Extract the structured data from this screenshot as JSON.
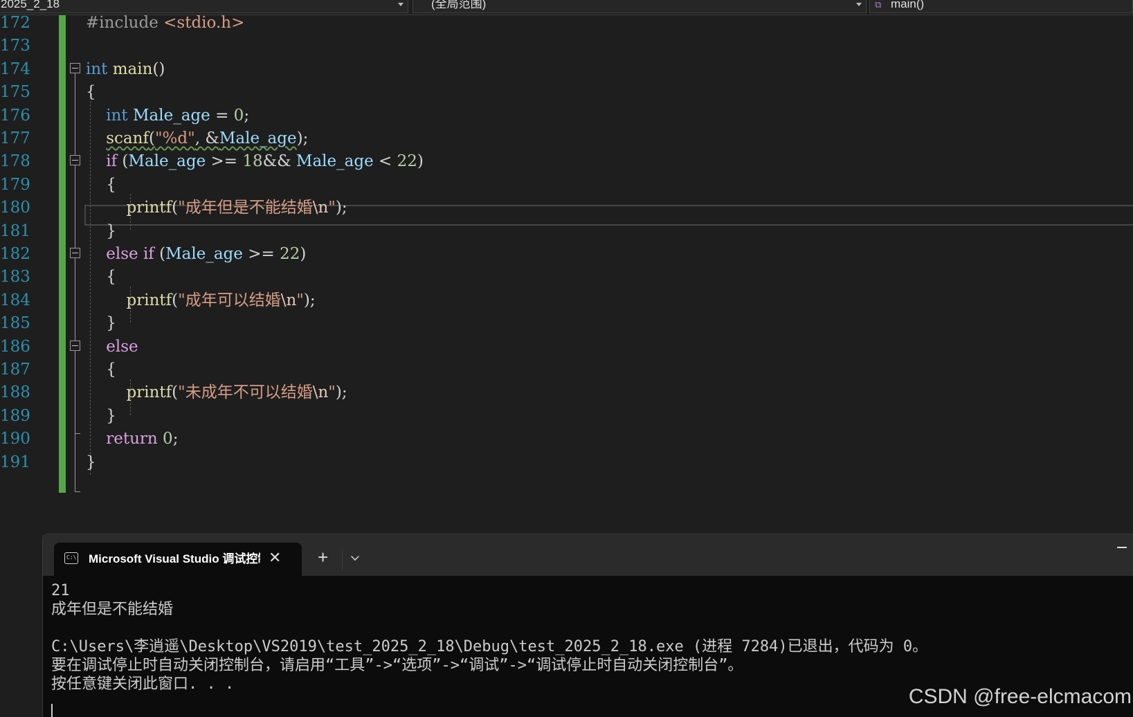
{
  "navbar": {
    "project": "2025_2_18",
    "scope": "(全局范围)",
    "member": "main()"
  },
  "editor": {
    "lines": [
      {
        "num": "172",
        "tokens": [
          {
            "t": "#include ",
            "c": "pre"
          },
          {
            "t": "<stdio.h>",
            "c": "str"
          }
        ]
      },
      {
        "num": "173",
        "tokens": []
      },
      {
        "num": "174",
        "tokens": [
          {
            "t": "int",
            "c": "kw"
          },
          {
            "t": " ",
            "c": ""
          },
          {
            "t": "main",
            "c": "fn"
          },
          {
            "t": "()",
            "c": ""
          }
        ]
      },
      {
        "num": "175",
        "tokens": [
          {
            "t": "{",
            "c": ""
          }
        ]
      },
      {
        "num": "176",
        "tokens": [
          {
            "t": "    ",
            "c": ""
          },
          {
            "t": "int",
            "c": "kw"
          },
          {
            "t": " ",
            "c": ""
          },
          {
            "t": "Male_age",
            "c": "var"
          },
          {
            "t": " = ",
            "c": ""
          },
          {
            "t": "0",
            "c": "num"
          },
          {
            "t": ";",
            "c": ""
          }
        ]
      },
      {
        "num": "177",
        "tokens": [
          {
            "t": "    ",
            "c": ""
          },
          {
            "t": "scanf",
            "c": "fn sq"
          },
          {
            "t": "(",
            "c": "sq"
          },
          {
            "t": "\"%d\"",
            "c": "str sq"
          },
          {
            "t": ", &",
            "c": "sq"
          },
          {
            "t": "Male_age",
            "c": "var sq"
          },
          {
            "t": ");",
            "c": ""
          }
        ]
      },
      {
        "num": "178",
        "tokens": [
          {
            "t": "    ",
            "c": ""
          },
          {
            "t": "if",
            "c": "ctl"
          },
          {
            "t": " (",
            "c": ""
          },
          {
            "t": "Male_age",
            "c": "var"
          },
          {
            "t": " >= ",
            "c": ""
          },
          {
            "t": "18",
            "c": "num"
          },
          {
            "t": "&& ",
            "c": ""
          },
          {
            "t": "Male_age",
            "c": "var"
          },
          {
            "t": " < ",
            "c": ""
          },
          {
            "t": "22",
            "c": "num"
          },
          {
            "t": ")",
            "c": ""
          }
        ]
      },
      {
        "num": "179",
        "tokens": [
          {
            "t": "    {",
            "c": ""
          }
        ]
      },
      {
        "num": "180",
        "tokens": [
          {
            "t": "        ",
            "c": ""
          },
          {
            "t": "printf",
            "c": "fn"
          },
          {
            "t": "(",
            "c": ""
          },
          {
            "t": "\"成年但是不能结婚",
            "c": "str"
          },
          {
            "t": "\\n",
            "c": "esc"
          },
          {
            "t": "\"",
            "c": "str"
          },
          {
            "t": ");",
            "c": ""
          }
        ]
      },
      {
        "num": "181",
        "tokens": [
          {
            "t": "    }",
            "c": ""
          }
        ]
      },
      {
        "num": "182",
        "tokens": [
          {
            "t": "    ",
            "c": ""
          },
          {
            "t": "else if",
            "c": "ctl"
          },
          {
            "t": " (",
            "c": ""
          },
          {
            "t": "Male_age",
            "c": "var"
          },
          {
            "t": " >= ",
            "c": ""
          },
          {
            "t": "22",
            "c": "num"
          },
          {
            "t": ")",
            "c": ""
          }
        ]
      },
      {
        "num": "183",
        "tokens": [
          {
            "t": "    {",
            "c": ""
          }
        ]
      },
      {
        "num": "184",
        "tokens": [
          {
            "t": "        ",
            "c": ""
          },
          {
            "t": "printf",
            "c": "fn"
          },
          {
            "t": "(",
            "c": ""
          },
          {
            "t": "\"成年可以结婚",
            "c": "str"
          },
          {
            "t": "\\n",
            "c": "esc"
          },
          {
            "t": "\"",
            "c": "str"
          },
          {
            "t": ");",
            "c": ""
          }
        ]
      },
      {
        "num": "185",
        "tokens": [
          {
            "t": "    }",
            "c": ""
          }
        ]
      },
      {
        "num": "186",
        "tokens": [
          {
            "t": "    ",
            "c": ""
          },
          {
            "t": "else",
            "c": "ctl"
          }
        ]
      },
      {
        "num": "187",
        "tokens": [
          {
            "t": "    {",
            "c": ""
          }
        ]
      },
      {
        "num": "188",
        "tokens": [
          {
            "t": "        ",
            "c": ""
          },
          {
            "t": "printf",
            "c": "fn"
          },
          {
            "t": "(",
            "c": ""
          },
          {
            "t": "\"未成年不可以结婚",
            "c": "str"
          },
          {
            "t": "\\n",
            "c": "esc"
          },
          {
            "t": "\"",
            "c": "str"
          },
          {
            "t": ");",
            "c": ""
          }
        ]
      },
      {
        "num": "189",
        "tokens": [
          {
            "t": "    }",
            "c": ""
          }
        ]
      },
      {
        "num": "190",
        "tokens": [
          {
            "t": "    ",
            "c": ""
          },
          {
            "t": "return",
            "c": "ctl"
          },
          {
            "t": " ",
            "c": ""
          },
          {
            "t": "0",
            "c": "num"
          },
          {
            "t": ";",
            "c": ""
          }
        ]
      },
      {
        "num": "191",
        "tokens": [
          {
            "t": "}",
            "c": ""
          }
        ]
      }
    ]
  },
  "console": {
    "tab_title": "Microsoft Visual Studio 调试控制台",
    "icon_text": "C:\\",
    "close_glyph": "✕",
    "add_glyph": "+",
    "output": [
      "21",
      "成年但是不能结婚",
      "",
      "C:\\Users\\李逍遥\\Desktop\\VS2019\\test_2025_2_18\\Debug\\test_2025_2_18.exe (进程 7284)已退出，代码为 0。",
      "要在调试停止时自动关闭控制台，请启用“工具”->“选项”->“调试”->“调试停止时自动关闭控制台”。",
      "按任意键关闭此窗口. . ."
    ]
  },
  "watermark": "CSDN @free-elcmacom"
}
